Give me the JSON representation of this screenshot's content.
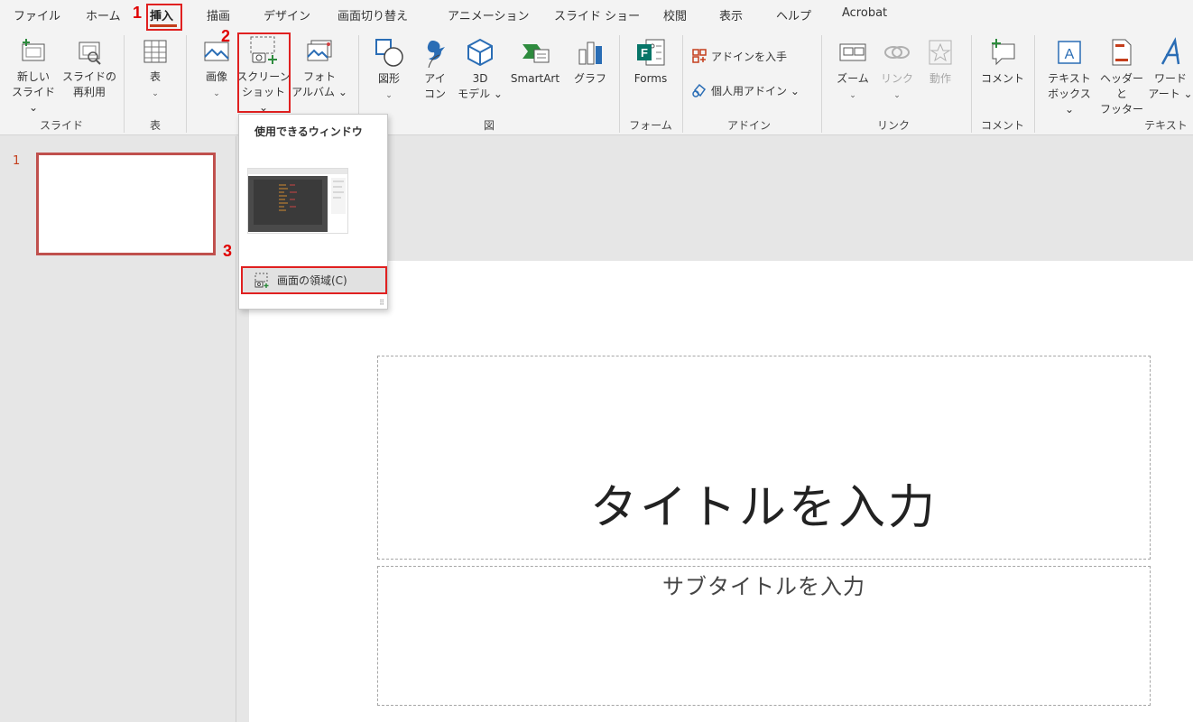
{
  "tabs": [
    "ファイル",
    "ホーム",
    "挿入",
    "描画",
    "デザイン",
    "画面切り替え",
    "アニメーション",
    "スライド ショー",
    "校閲",
    "表示",
    "ヘルプ",
    "Acrobat"
  ],
  "ribbon": {
    "slides": {
      "new_slide_1": "新しい",
      "new_slide_2": "スライド ⌄",
      "reuse_1": "スライドの",
      "reuse_2": "再利用",
      "group": "スライド"
    },
    "table": {
      "label": "表",
      "group": "表"
    },
    "images": {
      "image": "画像",
      "screenshot_1": "スクリーン",
      "screenshot_2": "ショット ⌄",
      "album_1": "フォト",
      "album_2": "アルバム ⌄"
    },
    "illustrations": {
      "shapes": "図形",
      "icons_1": "アイ",
      "icons_2": "コン",
      "model_1": "3D",
      "model_2": "モデル ⌄",
      "smartart": "SmartArt",
      "chart": "グラフ",
      "group": "図"
    },
    "forms": {
      "label": "Forms",
      "group": "フォーム"
    },
    "addins": {
      "get": "アドインを入手",
      "my": "個人用アドイン ⌄",
      "group": "アドイン"
    },
    "links": {
      "zoom": "ズーム",
      "link": "リンク",
      "action": "動作",
      "group": "リンク"
    },
    "comments": {
      "label": "コメント",
      "group": "コメント"
    },
    "text": {
      "textbox_1": "テキスト",
      "textbox_2": "ボックス ⌄",
      "header_1": "ヘッダーと",
      "header_2": "フッター",
      "wordart_1": "ワード",
      "wordart_2": "アート ⌄",
      "group": "テキスト"
    }
  },
  "dropdown": {
    "header": "使用できるウィンドウ",
    "item": "画面の領域(C)"
  },
  "thumbnail": {
    "number": "1"
  },
  "slide": {
    "title_placeholder": "タイトルを入力",
    "subtitle_placeholder": "サブタイトルを入力"
  },
  "steps": [
    "1",
    "2",
    "3"
  ],
  "colors": {
    "accent": "#c43e1c",
    "annotation": "#e02020"
  }
}
